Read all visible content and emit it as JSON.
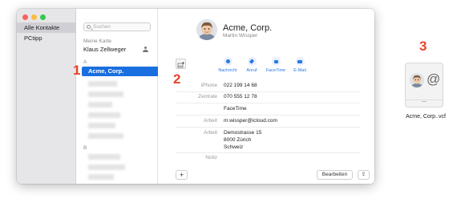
{
  "sidebar": {
    "groups": [
      "Alle Kontakte",
      "PCtipp"
    ]
  },
  "list": {
    "search_placeholder": "Suchen",
    "my_card_header": "Meine Karte",
    "my_card_name": "Klaus Zellweger",
    "section_a": "A",
    "selected_contact": "Acme, Corp.",
    "section_b": "B"
  },
  "detail": {
    "name": "Acme, Corp.",
    "subtitle": "Martin Wissper",
    "actions": [
      "Nachricht",
      "Anruf",
      "FaceTime",
      "E-Mail"
    ],
    "fields": [
      {
        "label": "iPhone",
        "value": "022 199 14 68"
      },
      {
        "label": "Zentrale",
        "value": "070 555 12 78"
      },
      {
        "label": "",
        "value": "FaceTime"
      },
      {
        "label": "Arbeit",
        "value": "m.wissper@icloud.com"
      },
      {
        "label": "Arbeit",
        "value": "Demostrasse 15"
      },
      {
        "label": "Notiz",
        "value": ""
      }
    ],
    "address_line2": "8000 Zürich",
    "address_line3": "Schweiz",
    "add_label": "+",
    "edit_label": "Bearbeiten",
    "share_label": "⇪"
  },
  "markers": [
    "1",
    "2",
    "3"
  ],
  "file": {
    "name": "Acme, Corp..vcf",
    "at_symbol": "@"
  },
  "colors": {
    "selection": "#1a6fe0",
    "action_blue": "#2b78e4",
    "marker_red": "#e8442b"
  }
}
